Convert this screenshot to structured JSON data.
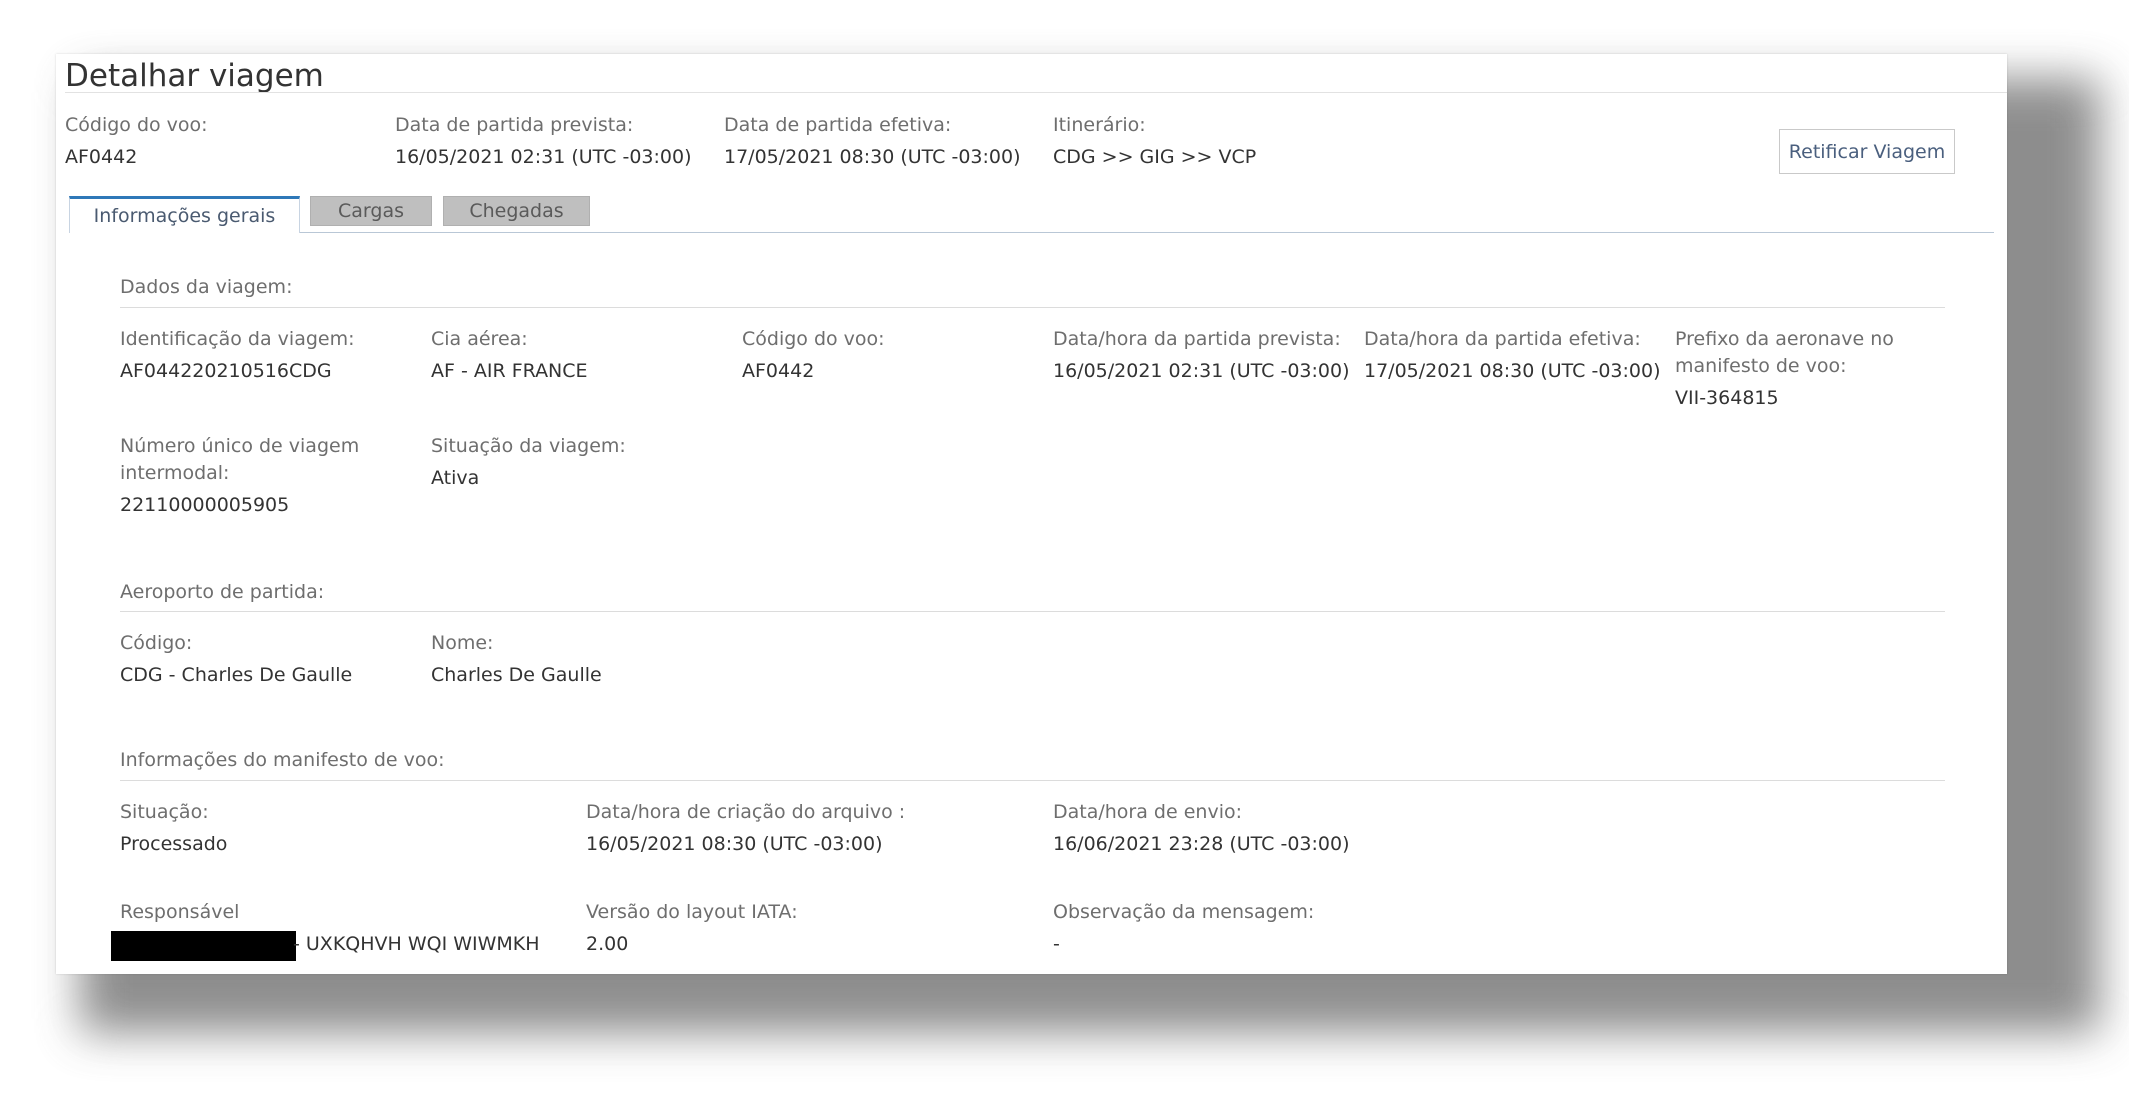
{
  "page": {
    "title": "Detalhar viagem",
    "button_label": "Retificar Viagem"
  },
  "header": {
    "codigo_label": "Código do voo:",
    "codigo_value": "AF0442",
    "partida_prevista_label": "Data de partida prevista:",
    "partida_prevista_value": "16/05/2021 02:31 (UTC -03:00)",
    "partida_efetiva_label": "Data de partida efetiva:",
    "partida_efetiva_value": "17/05/2021 08:30 (UTC -03:00)",
    "itinerario_label": "Itinerário:",
    "itinerario_value": "CDG >> GIG >> VCP"
  },
  "tabs": [
    {
      "label": "Informações gerais",
      "active": true
    },
    {
      "label": "Cargas",
      "active": false
    },
    {
      "label": "Chegadas",
      "active": false
    }
  ],
  "dados": {
    "section_title": "Dados da viagem:",
    "identificacao_label": "Identificação da viagem:",
    "identificacao_value": "AF044220210516CDG",
    "cia_label": "Cia aérea:",
    "cia_value": "AF - AIR FRANCE",
    "codigo_label": "Código do voo:",
    "codigo_value": "AF0442",
    "partida_prevista_label": "Data/hora da partida prevista:",
    "partida_prevista_value": "16/05/2021 02:31 (UTC -03:00)",
    "partida_efetiva_label": "Data/hora da partida efetiva:",
    "partida_efetiva_value": "17/05/2021 08:30 (UTC -03:00)",
    "prefixo_label_line1": "Prefixo da aeronave no",
    "prefixo_label_line2": "manifesto de voo:",
    "prefixo_value": "VII-364815",
    "numero_label_line1": "Número único de viagem",
    "numero_label_line2": "intermodal:",
    "numero_value": "22110000005905",
    "situacao_label": "Situação da viagem:",
    "situacao_value": "Ativa"
  },
  "aeroporto": {
    "section_title": "Aeroporto de partida:",
    "codigo_label": "Código:",
    "codigo_value": "CDG - Charles De Gaulle",
    "nome_label": "Nome:",
    "nome_value": "Charles De Gaulle"
  },
  "manifesto": {
    "section_title": "Informações do manifesto de voo:",
    "situacao_label": "Situação:",
    "situacao_value": "Processado",
    "criacao_label": "Data/hora de criação do arquivo :",
    "criacao_value": "16/05/2021 08:30 (UTC -03:00)",
    "envio_label": "Data/hora de envio:",
    "envio_value": "16/06/2021 23:28 (UTC -03:00)",
    "responsavel_label": "Responsável",
    "responsavel_value": "- UXKQHVH WQI WIWMKH",
    "versao_label": "Versão do layout IATA:",
    "versao_value": "2.00",
    "observacao_label": "Observação da mensagem:",
    "observacao_value": "-"
  }
}
